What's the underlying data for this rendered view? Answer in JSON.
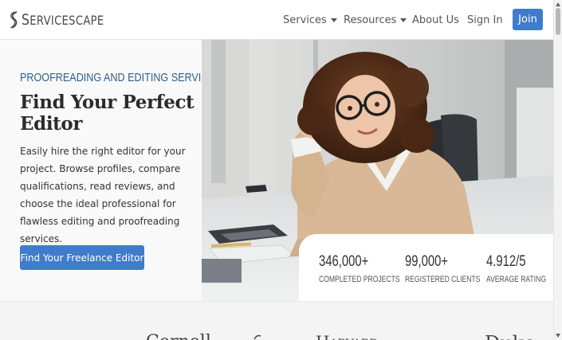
{
  "header": {
    "logo": {
      "text_lead": "S",
      "text_rest": "ERVICESCAPE"
    },
    "nav": [
      {
        "label": "Services",
        "has_dropdown": true
      },
      {
        "label": "Resources",
        "has_dropdown": true
      },
      {
        "label": "About Us",
        "has_dropdown": false
      },
      {
        "label": "Sign In",
        "has_dropdown": false
      }
    ],
    "join_label": "Join"
  },
  "hero": {
    "eyebrow": "PROOFREADING AND EDITING SERVICES",
    "title": "Find Your Perfect Editor",
    "description": "Easily hire the right editor for your project. Browse profiles, compare qualifications, read reviews, and choose the ideal professional for flawless editing and proofreading services.",
    "cta_label": "Find Your Freelance Editor",
    "photo_icon": "woman-at-desk-photo"
  },
  "stats": [
    {
      "value": "346,000+",
      "label": "COMPLETED PROJECTS"
    },
    {
      "value": "99,000+",
      "label": "REGISTERED CLIENTS"
    },
    {
      "value": "4.912/5",
      "label": "AVERAGE RATING"
    }
  ],
  "clients": {
    "partial_logos": [
      "Cornell",
      "Harvard",
      "Duke"
    ]
  },
  "colors": {
    "accent": "#3f7ccb",
    "eyebrow": "#2f5d88",
    "title": "#2b2b2b",
    "hero_left_bg": "#f9f9f9"
  }
}
